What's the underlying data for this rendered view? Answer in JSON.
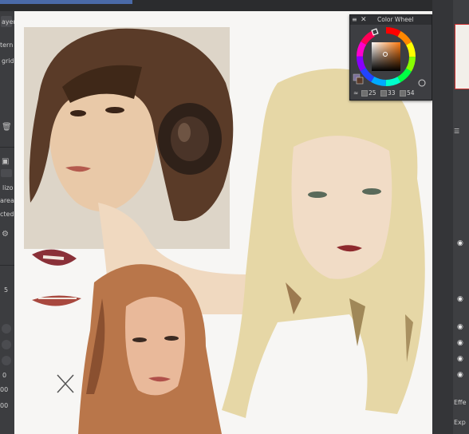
{
  "left_panel": {
    "labels": [
      "ayer",
      "tern",
      "grid",
      "lizo",
      "area",
      "cted",
      "5",
      "0",
      "00",
      "00"
    ]
  },
  "color_wheel": {
    "title": "Color Wheel",
    "values": {
      "h": "25",
      "s": "33",
      "v": "54"
    },
    "current_color": "#5a3a2a",
    "background_color": "#7b6f9a"
  },
  "right_panel": {
    "labels": [
      "Effe",
      "Exp"
    ]
  },
  "colors": {
    "canvas_bg": "#f7f6f4",
    "panel_bg": "#3c3d40",
    "accent": "#4a6aa8"
  }
}
